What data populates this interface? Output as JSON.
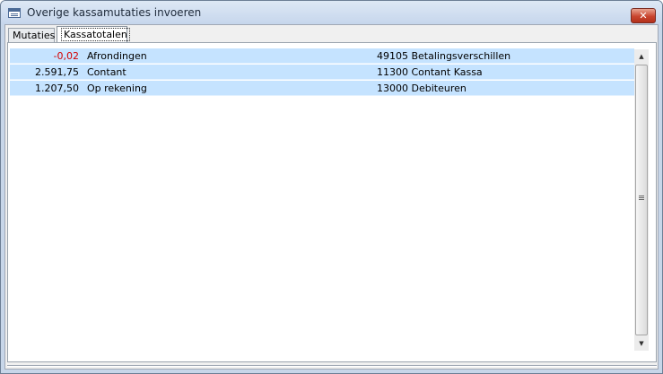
{
  "window": {
    "title": "Overige kassamutaties invoeren",
    "close_glyph": "✕"
  },
  "tabs": [
    {
      "label": "Mutaties",
      "active": false
    },
    {
      "label": "Kassatotalen",
      "active": true
    }
  ],
  "rows": [
    {
      "amount": "-0,02",
      "description": "Afrondingen",
      "account": "49105 Betalingsverschillen",
      "negative": true
    },
    {
      "amount": "2.591,75",
      "description": "Contant",
      "account": "11300 Contant Kassa",
      "negative": false
    },
    {
      "amount": "1.207,50",
      "description": "Op rekening",
      "account": "13000 Debiteuren",
      "negative": false
    }
  ],
  "icons": {
    "app": "form-window-icon",
    "close": "close-icon",
    "scroll_up": "scroll-up-arrow-icon",
    "scroll_down": "scroll-down-arrow-icon"
  },
  "colors": {
    "row_highlight": "#c5e3ff",
    "negative_amount": "#d40000",
    "close_button": "#c9452f"
  }
}
